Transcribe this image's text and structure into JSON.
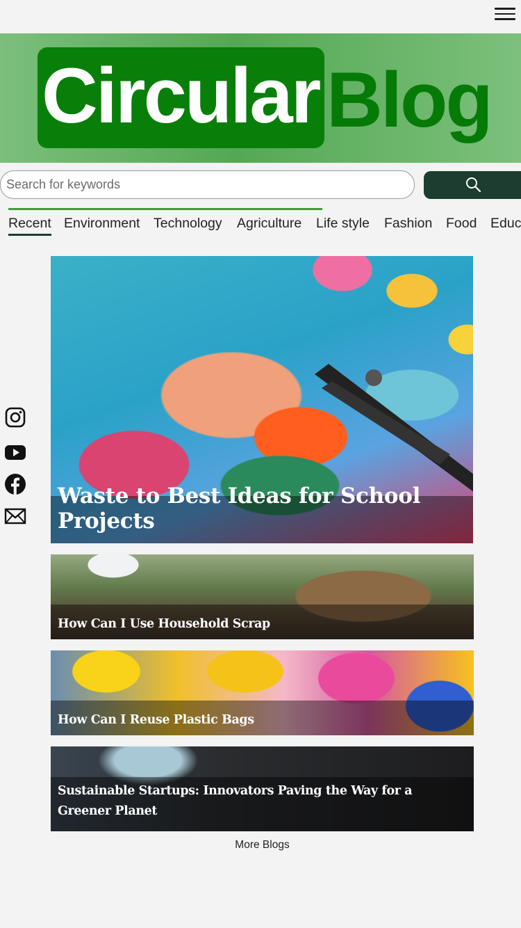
{
  "header": {
    "menu_icon": "hamburger-icon"
  },
  "banner": {
    "logo_part1": "Circular",
    "logo_part2": "Blog",
    "colors": {
      "logo_box": "#087f08",
      "logo_blog": "#067a06",
      "banner": "#5aab5a"
    }
  },
  "search": {
    "placeholder": "Search for keywords",
    "value": "",
    "button_icon": "search-icon",
    "button_color": "#1c3d2f"
  },
  "categories": {
    "active_index": 0,
    "items": [
      "Recent",
      "Environment",
      "Technology",
      "Agriculture",
      "Life style",
      "Fashion",
      "Food",
      "Educ"
    ]
  },
  "social": {
    "icons": [
      "instagram-icon",
      "youtube-icon",
      "facebook-icon",
      "email-icon"
    ]
  },
  "posts": [
    {
      "title": "Waste to Best Ideas for School Projects"
    },
    {
      "title": "How Can I Use Household Scrap"
    },
    {
      "title": "How Can I Reuse Plastic Bags"
    },
    {
      "title": "Sustainable Startups: Innovators Paving the Way for a Greener Planet"
    }
  ],
  "more_link": "More Blogs"
}
